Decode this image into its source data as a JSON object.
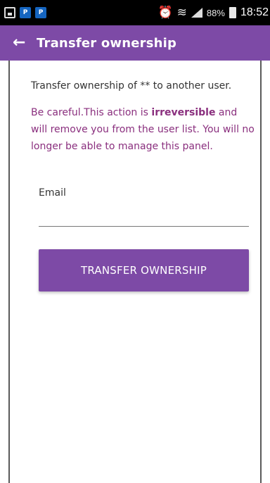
{
  "status_bar": {
    "notification_icons": [
      "gallery-icon",
      "playstation-icon",
      "playstation-icon"
    ],
    "battery_percent": "88%",
    "time": "18:52"
  },
  "app_bar": {
    "title": "Transfer ownership",
    "background_color": "#7d4aa6"
  },
  "content": {
    "intro": "Transfer ownership of ** to another user.",
    "warning_prefix": "Be careful.This action is ",
    "warning_emphasis": "irreversible",
    "warning_suffix": " and will remove you from the user list. You will no longer be able to manage this panel.",
    "warning_color": "#8a2f7e"
  },
  "form": {
    "email_label": "Email",
    "email_value": "",
    "submit_label": "TRANSFER OWNERSHIP"
  }
}
